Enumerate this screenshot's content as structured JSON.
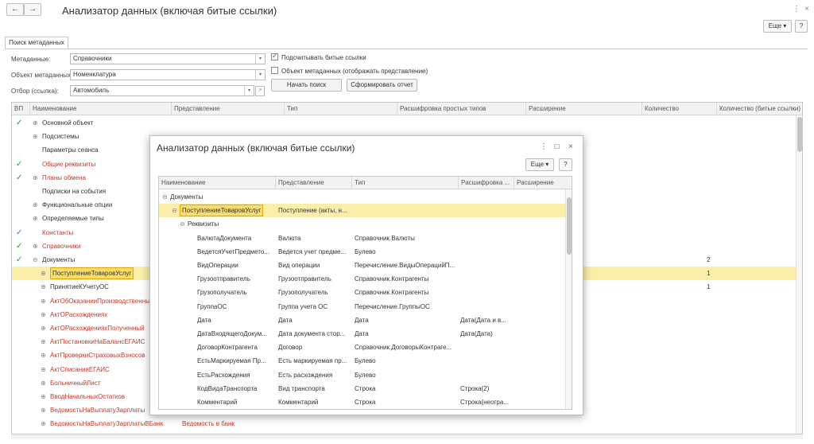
{
  "window": {
    "title": "Анализатор данных (включая битые ссылки)",
    "back": "←",
    "forward": "→",
    "more_label": "Еще",
    "help_label": "?"
  },
  "tabs": [
    {
      "label": "Поиск метаданных"
    }
  ],
  "form": {
    "metadata_label": "Метаданные:",
    "metadata_value": "Справочники",
    "object_label": "Объект метаданных:",
    "object_value": "Номенклатура",
    "filter_label": "Отбор (ссылка):",
    "filter_value": "Автомобиль",
    "count_broken_label": "Подсчитывать битые ссылки",
    "count_broken_checked": true,
    "show_repr_label": "Объект метаданных (отображать представление)",
    "show_repr_checked": false,
    "start_button": "Начать поиск",
    "report_button": "Сформировать отчет"
  },
  "main_table": {
    "columns": [
      "ВП",
      "Наименование",
      "Представление",
      "Тип",
      "Расшифровка простых типов",
      "Расширение",
      "Количество",
      "Количество (битые ссылки)"
    ],
    "rows": [
      {
        "vp": "✓",
        "exp": "⊕",
        "name": "Основной объект",
        "red": false,
        "count": ""
      },
      {
        "vp": "",
        "exp": "⊕",
        "name": "Подсистемы",
        "red": false,
        "count": ""
      },
      {
        "vp": "",
        "exp": "",
        "name": "Параметры сеанса",
        "red": false,
        "count": ""
      },
      {
        "vp": "✓",
        "exp": "",
        "name": "Общие реквизиты",
        "red": true,
        "count": ""
      },
      {
        "vp": "✓",
        "exp": "⊕",
        "name": "Планы обмена",
        "red": true,
        "count": ""
      },
      {
        "vp": "",
        "exp": "",
        "name": "Подписки на события",
        "red": false,
        "count": ""
      },
      {
        "vp": "",
        "exp": "⊕",
        "name": "Функциональные опции",
        "red": false,
        "count": ""
      },
      {
        "vp": "",
        "exp": "⊕",
        "name": "Определяемые типы",
        "red": false,
        "count": ""
      },
      {
        "vp": "✓",
        "exp": "",
        "name": "Константы",
        "red": true,
        "count": ""
      },
      {
        "vp": "✓",
        "exp": "⊕",
        "name": "Справочники",
        "red": true,
        "count": ""
      },
      {
        "vp": "✓",
        "exp": "⊖",
        "name": "Документы",
        "red": false,
        "count": "2"
      },
      {
        "vp": "",
        "exp": "⊕",
        "name": "ПоступлениеТоваровУслуг",
        "red": false,
        "count": "1",
        "selected": true
      },
      {
        "vp": "",
        "exp": "⊕",
        "name": "ПринятиеКУчетуОС",
        "red": false,
        "count": "1"
      },
      {
        "vp": "",
        "exp": "⊕",
        "name": "АктОбОказанииПроизводственныхУслуг",
        "red": true,
        "count": ""
      },
      {
        "vp": "",
        "exp": "⊕",
        "name": "АктОРасхождениях",
        "red": true,
        "count": ""
      },
      {
        "vp": "",
        "exp": "⊕",
        "name": "АктОРасхожденияхПолученный",
        "red": true,
        "count": ""
      },
      {
        "vp": "",
        "exp": "⊕",
        "name": "АктПостановкиНаБалансЕГАИС",
        "red": true,
        "count": ""
      },
      {
        "vp": "",
        "exp": "⊕",
        "name": "АктПроверкиСтраховыхВзносов",
        "red": true,
        "count": ""
      },
      {
        "vp": "",
        "exp": "⊕",
        "name": "АктСписанияЕГАИС",
        "red": true,
        "count": ""
      },
      {
        "vp": "",
        "exp": "⊕",
        "name": "БольничныйЛист",
        "red": true,
        "count": ""
      },
      {
        "vp": "",
        "exp": "⊕",
        "name": "ВводНачальныхОстатков",
        "red": true,
        "count": ""
      },
      {
        "vp": "",
        "exp": "⊕",
        "name": "ВедомостьНаВыплатуЗарплаты",
        "red": true,
        "count": ""
      },
      {
        "vp": "",
        "exp": "⊕",
        "name": "ВедомостьНаВыплатуЗарплатыВБанк",
        "red": true,
        "repr": "Ведомость в банк",
        "count": ""
      }
    ]
  },
  "modal": {
    "title": "Анализатор данных (включая битые ссылки)",
    "more_label": "Еще",
    "help_label": "?",
    "columns": [
      "Наименование",
      "Представление",
      "Тип",
      "Расшифровка ...",
      "Расширение"
    ],
    "rows": [
      {
        "indent": 0,
        "exp": "⊖",
        "name": "Документы",
        "repr": "",
        "type": "",
        "decode": ""
      },
      {
        "indent": 1,
        "exp": "⊖",
        "name": "ПоступлениеТоваровУслуг",
        "repr": "Поступление (акты, н...",
        "type": "",
        "decode": "",
        "selected": true
      },
      {
        "indent": 2,
        "exp": "⊖",
        "name": "Реквизиты",
        "repr": "",
        "type": "",
        "decode": ""
      },
      {
        "indent": 3,
        "exp": "",
        "name": "ВалютаДокумента",
        "repr": "Валюта",
        "type": "Справочник.Валюты",
        "decode": ""
      },
      {
        "indent": 3,
        "exp": "",
        "name": "ВедетсяУчетПредмето...",
        "repr": "Ведется учет предме...",
        "type": "Булево",
        "decode": ""
      },
      {
        "indent": 3,
        "exp": "",
        "name": "ВидОперации",
        "repr": "Вид операции",
        "type": "Перечисление.ВидыОперацийП...",
        "decode": ""
      },
      {
        "indent": 3,
        "exp": "",
        "name": "Грузоотправитель",
        "repr": "Грузоотправитель",
        "type": "Справочник.Контрагенты",
        "decode": ""
      },
      {
        "indent": 3,
        "exp": "",
        "name": "Грузополучатель",
        "repr": "Грузополучатель",
        "type": "Справочник.Контрагенты",
        "decode": ""
      },
      {
        "indent": 3,
        "exp": "",
        "name": "ГруппаОС",
        "repr": "Группа учета ОС",
        "type": "Перечисление.ГруппыОС",
        "decode": ""
      },
      {
        "indent": 3,
        "exp": "",
        "name": "Дата",
        "repr": "Дата",
        "type": "Дата",
        "decode": "Дата(Дата и в..."
      },
      {
        "indent": 3,
        "exp": "",
        "name": "ДатаВходящегоДокум...",
        "repr": "Дата документа стор...",
        "type": "Дата",
        "decode": "Дата(Дата)"
      },
      {
        "indent": 3,
        "exp": "",
        "name": "ДоговорКонтрагента",
        "repr": "Договор",
        "type": "Справочник.ДоговорыКонтраге...",
        "decode": ""
      },
      {
        "indent": 3,
        "exp": "",
        "name": "ЕстьМаркируемая Пр...",
        "repr": "Есть маркируемая пр...",
        "type": "Булево",
        "decode": ""
      },
      {
        "indent": 3,
        "exp": "",
        "name": "ЕстьРасхождения",
        "repr": "Есть расхождения",
        "type": "Булево",
        "decode": ""
      },
      {
        "indent": 3,
        "exp": "",
        "name": "КодВидаТранспорта",
        "repr": "Вид транспорта",
        "type": "Строка",
        "decode": "Строка(2)"
      },
      {
        "indent": 3,
        "exp": "",
        "name": "Комментарий",
        "repr": "Комментарий",
        "type": "Строка",
        "decode": "Строка(неогра..."
      }
    ]
  },
  "icons": {
    "back": "arrow-left-icon",
    "forward": "arrow-right-icon",
    "kebab": "kebab-icon",
    "close": "close-icon"
  },
  "colors": {
    "accent_red": "#c0392b",
    "check_green": "#2a9d2a",
    "selected_row": "#fbeea8"
  }
}
